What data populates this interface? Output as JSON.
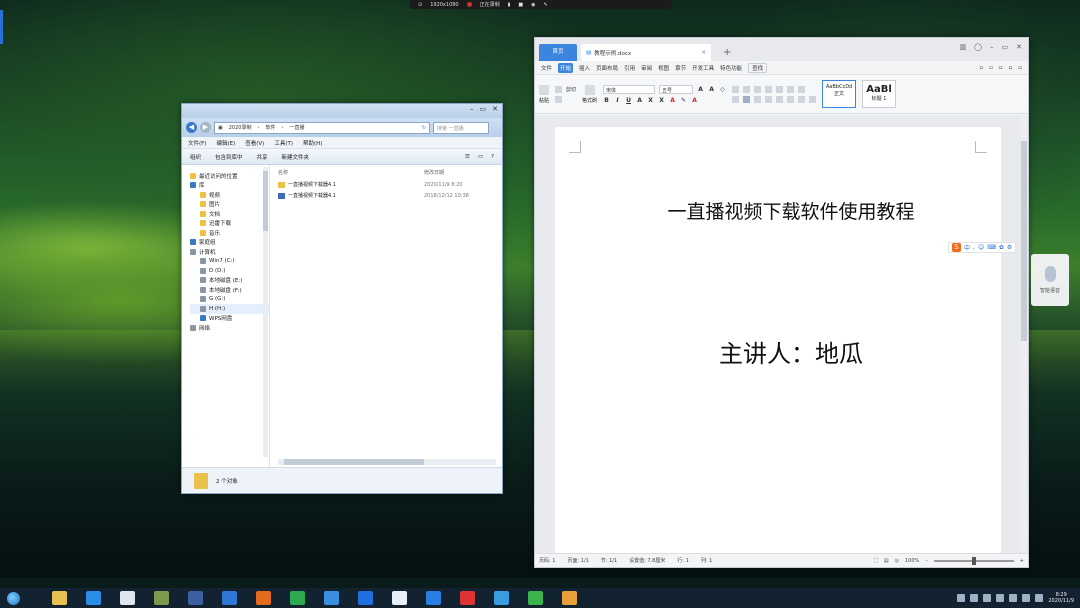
{
  "capture_bar": {
    "resolution": "1920x1080",
    "status": "正在录制"
  },
  "explorer": {
    "nav_back_icon": "back-arrow-icon",
    "nav_forward_icon": "forward-arrow-icon",
    "address": [
      "2020录制",
      "软件",
      "一直播"
    ],
    "search_placeholder": "搜索 一直播",
    "menu": [
      "文件(F)",
      "编辑(E)",
      "查看(V)",
      "工具(T)",
      "帮助(H)"
    ],
    "toolbar": [
      "组织",
      "包含到库中",
      "共享",
      "新建文件夹"
    ],
    "nav_items": [
      {
        "label": "最近访问的位置",
        "indent": false,
        "icon": "recent-icon"
      },
      {
        "label": "库",
        "indent": false,
        "icon": "library-icon",
        "gap_before": true
      },
      {
        "label": "视频",
        "indent": true,
        "icon": "video-icon"
      },
      {
        "label": "图片",
        "indent": true,
        "icon": "picture-icon"
      },
      {
        "label": "文档",
        "indent": true,
        "icon": "document-icon"
      },
      {
        "label": "迅雷下载",
        "indent": true,
        "icon": "download-icon"
      },
      {
        "label": "音乐",
        "indent": true,
        "icon": "music-icon"
      },
      {
        "label": "家庭组",
        "indent": false,
        "icon": "homegroup-icon",
        "gap_before": true
      },
      {
        "label": "计算机",
        "indent": false,
        "icon": "computer-icon",
        "gap_before": true
      },
      {
        "label": "Win7 (C:)",
        "indent": true,
        "icon": "drive-icon"
      },
      {
        "label": "D (D:)",
        "indent": true,
        "icon": "drive-icon"
      },
      {
        "label": "本地磁盘 (E:)",
        "indent": true,
        "icon": "drive-icon"
      },
      {
        "label": "本地磁盘 (F:)",
        "indent": true,
        "icon": "drive-icon"
      },
      {
        "label": "G (G:)",
        "indent": true,
        "icon": "drive-icon"
      },
      {
        "label": "H (H:)",
        "indent": true,
        "icon": "drive-icon",
        "selected": true
      },
      {
        "label": "WPS网盘",
        "indent": true,
        "icon": "cloud-icon"
      },
      {
        "label": "网络",
        "indent": false,
        "icon": "network-icon",
        "gap_before": true
      }
    ],
    "columns": [
      "名称",
      "修改日期"
    ],
    "files": [
      {
        "name": "一直播视频下载器4.1",
        "date": "2020/11/9 8:20",
        "icon": "folder-icon"
      },
      {
        "name": "一直播视频下载器4.1",
        "date": "2018/12/12 10:38",
        "icon": "app-icon"
      }
    ],
    "status": "2 个对象"
  },
  "wps": {
    "home_tab": "首页",
    "doc_tab": "教程示例.docx",
    "menu": [
      "文件",
      "开始",
      "插入",
      "页面布局",
      "引用",
      "审阅",
      "视图",
      "章节",
      "开发工具",
      "特色功能",
      "查找"
    ],
    "active_menu": "开始",
    "ribbon": {
      "paste": "粘贴",
      "cut": "剪切",
      "format_painter": "格式刷",
      "font": "宋体",
      "size": "五号",
      "style_normal_preview": "AaBbCcDd",
      "style_normal": "正文",
      "style_h1_preview": "AaBl",
      "style_h1": "标题 1"
    },
    "doc_title": "一直播视频下载软件使用教程",
    "doc_subtitle": "主讲人：地瓜",
    "status_left": [
      "页码: 1",
      "页面: 1/1",
      "节: 1/1",
      "设置值: 7.8厘米",
      "行: 1",
      "列: 1"
    ],
    "zoom": "100%"
  },
  "ime": {
    "label": "中",
    "voice_label": "智能语音"
  },
  "taskbar": {
    "apps": [
      {
        "name": "file-explorer-icon",
        "color": "#e8c050"
      },
      {
        "name": "xunlei-icon",
        "color": "#2a8ee6"
      },
      {
        "name": "baidu-netdisk-icon",
        "color": "#dfe6ee"
      },
      {
        "name": "photo-icon",
        "color": "#7b9a4a"
      },
      {
        "name": "calculator-icon",
        "color": "#3b5fa0"
      },
      {
        "name": "blue-app-icon",
        "color": "#2f77d6"
      },
      {
        "name": "firefox-icon",
        "color": "#e46a1c"
      },
      {
        "name": "chrome-icon",
        "color": "#2da94f"
      },
      {
        "name": "network-app-icon",
        "color": "#3a8fe0"
      },
      {
        "name": "wps-icon",
        "color": "#1f6fe0"
      },
      {
        "name": "info-app-icon",
        "color": "#e8eef5"
      },
      {
        "name": "wps-writer-icon",
        "color": "#2a7de2"
      },
      {
        "name": "record-icon",
        "color": "#d33"
      },
      {
        "name": "send-icon",
        "color": "#3a9de0"
      },
      {
        "name": "wechat-icon",
        "color": "#3cb34a"
      },
      {
        "name": "package-icon",
        "color": "#e8a13a"
      }
    ],
    "time": "8:29",
    "date": "2020/11/9"
  }
}
